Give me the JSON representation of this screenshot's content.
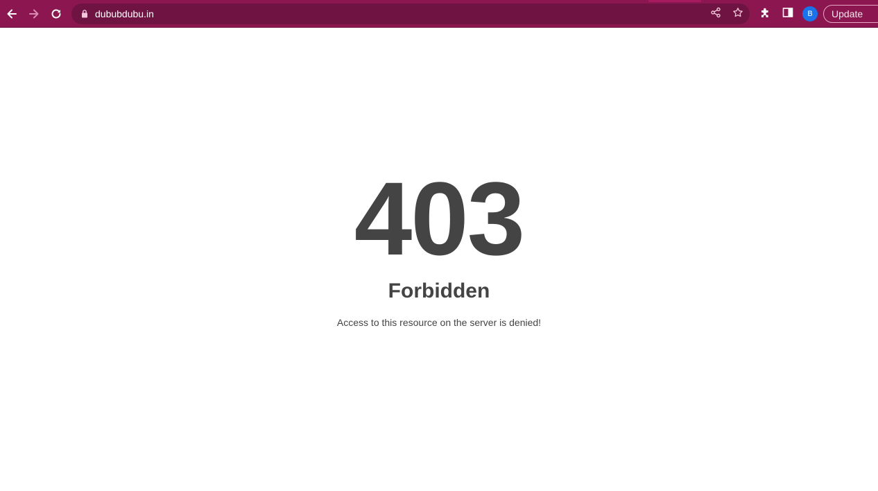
{
  "browser": {
    "url": "dububdubu.in",
    "avatar_initial": "B",
    "update_label": "Update",
    "toolbar_color": "#8b1650",
    "omnibox_color": "#6f1442",
    "icons": [
      "back-icon",
      "forward-icon",
      "reload-icon",
      "lock-icon",
      "share-icon",
      "star-icon",
      "extensions-icon",
      "side-panel-icon"
    ]
  },
  "page": {
    "code": "403",
    "title": "Forbidden",
    "message": "Access to this resource on the server is denied!"
  }
}
